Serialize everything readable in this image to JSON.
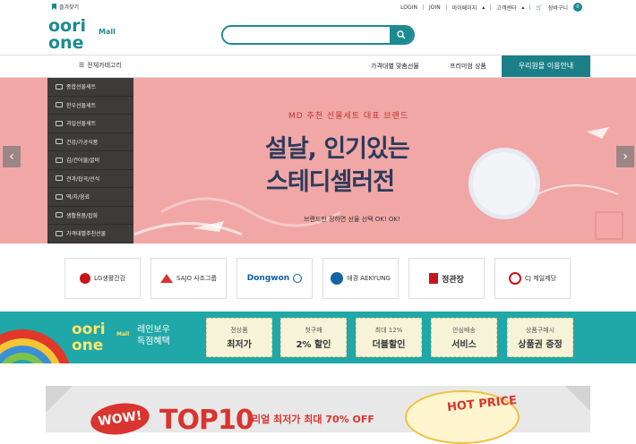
{
  "topbar": {
    "bookmark": "즐겨찾기",
    "links": [
      "LOGIN",
      "JOIN",
      "마이페이지",
      "고객센터"
    ],
    "cart_label": "장바구니",
    "cart_count": "0"
  },
  "logo": {
    "line1": "oori",
    "line2": "one",
    "tag": "Mall"
  },
  "search": {
    "placeholder": ""
  },
  "nav": {
    "category_label": "전체카테고리",
    "items": [
      "가격대별 맞춤선물",
      "프리미엄 상품"
    ],
    "highlight": "우리원몰 이용안내"
  },
  "categories": [
    "종합선물세트",
    "한우선물세트",
    "과일선물세트",
    "건강/가공식품",
    "김/건어물/굴비",
    "견과/잡곡/선식",
    "떡/차/음료",
    "생활용품/잡화",
    "가격대별추천선물"
  ],
  "banner": {
    "subtitle": "MD 추천 선물세트 대표 브랜드",
    "title1": "설날, 인기있는",
    "title2": "스테디셀러전",
    "caption": "브랜드만 정하면 선물 선택 OK! OK!"
  },
  "brands": [
    "LG생활건강",
    "SAJO 사조그룹",
    "Dongwon",
    "애경 AEKYUNG",
    "정관장",
    "CJ 제일제당"
  ],
  "promo": {
    "title_line1": "레인보우",
    "title_line2": "독점혜택",
    "tickets": [
      {
        "small": "전상품",
        "big": "최저가"
      },
      {
        "small": "첫구매",
        "big": "2% 할인"
      },
      {
        "small": "최대 12%",
        "big": "더블할인"
      },
      {
        "small": "안심배송",
        "big": "서비스"
      },
      {
        "small": "상품구매시",
        "big": "상품권 증정"
      }
    ]
  },
  "bottom": {
    "wow": "WOW!",
    "top10": "TOP10",
    "caption": "리얼 최저가 최대 70% OFF",
    "hot": "HOT PRICE"
  },
  "colors": {
    "accent": "#1c8a92",
    "banner_bg": "#f1a7a6",
    "promo_bg": "#20a7a7"
  }
}
